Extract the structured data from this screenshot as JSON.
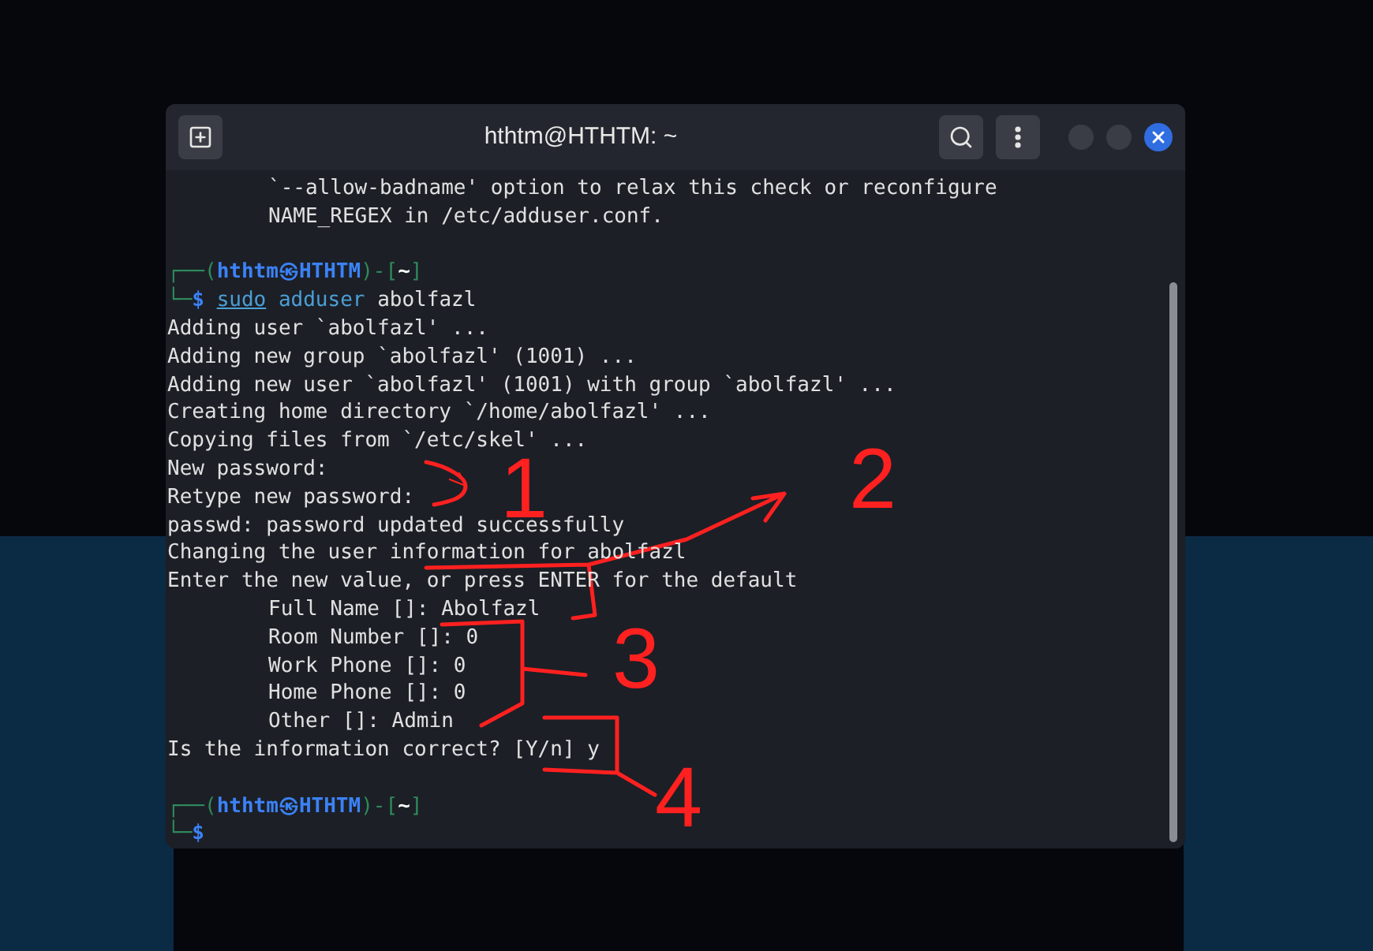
{
  "window": {
    "title": "hthtm@HTHTM: ~"
  },
  "terminal": {
    "lines": [
      {
        "kind": "text",
        "indented": true,
        "text": "`--allow-badname' option to relax this check or reconfigure"
      },
      {
        "kind": "text",
        "indented": true,
        "text": "NAME_REGEX in /etc/adduser.conf."
      },
      {
        "kind": "blank"
      },
      {
        "kind": "prompt_top",
        "corner": "┌──(",
        "user": "hthtm",
        "at": "㉿",
        "host": "HTHTM",
        "mid": ")-[",
        "dir": "~",
        "end": "]"
      },
      {
        "kind": "prompt_cmd",
        "corner": "└─",
        "sign": "$",
        "words": [
          {
            "text": "sudo",
            "underlined": true,
            "highlighted": true
          },
          {
            "text": "adduser",
            "underlined": false,
            "highlighted": true
          },
          {
            "text": "abolfazl",
            "underlined": false,
            "highlighted": false
          }
        ]
      },
      {
        "kind": "text",
        "indented": false,
        "text": "Adding user `abolfazl' ..."
      },
      {
        "kind": "text",
        "indented": false,
        "text": "Adding new group `abolfazl' (1001) ..."
      },
      {
        "kind": "text",
        "indented": false,
        "text": "Adding new user `abolfazl' (1001) with group `abolfazl' ..."
      },
      {
        "kind": "text",
        "indented": false,
        "text": "Creating home directory `/home/abolfazl' ..."
      },
      {
        "kind": "text",
        "indented": false,
        "text": "Copying files from `/etc/skel' ..."
      },
      {
        "kind": "text",
        "indented": false,
        "text": "New password:"
      },
      {
        "kind": "text",
        "indented": false,
        "text": "Retype new password:"
      },
      {
        "kind": "text",
        "indented": false,
        "text": "passwd: password updated successfully"
      },
      {
        "kind": "text",
        "indented": false,
        "text": "Changing the user information for abolfazl"
      },
      {
        "kind": "text",
        "indented": false,
        "text": "Enter the new value, or press ENTER for the default"
      },
      {
        "kind": "text",
        "indented": true,
        "text": "Full Name []: Abolfazl"
      },
      {
        "kind": "text",
        "indented": true,
        "text": "Room Number []: 0"
      },
      {
        "kind": "text",
        "indented": true,
        "text": "Work Phone []: 0"
      },
      {
        "kind": "text",
        "indented": true,
        "text": "Home Phone []: 0"
      },
      {
        "kind": "text",
        "indented": true,
        "text": "Other []: Admin"
      },
      {
        "kind": "text",
        "indented": false,
        "text": "Is the information correct? [Y/n] y"
      },
      {
        "kind": "blank"
      },
      {
        "kind": "prompt_top",
        "corner": "┌──(",
        "user": "hthtm",
        "at": "㉿",
        "host": "HTHTM",
        "mid": ")-[",
        "dir": "~",
        "end": "]"
      },
      {
        "kind": "prompt_cmd",
        "corner": "└─",
        "sign": "$"
      }
    ]
  },
  "annotations": [
    "1",
    "2",
    "3",
    "4"
  ]
}
